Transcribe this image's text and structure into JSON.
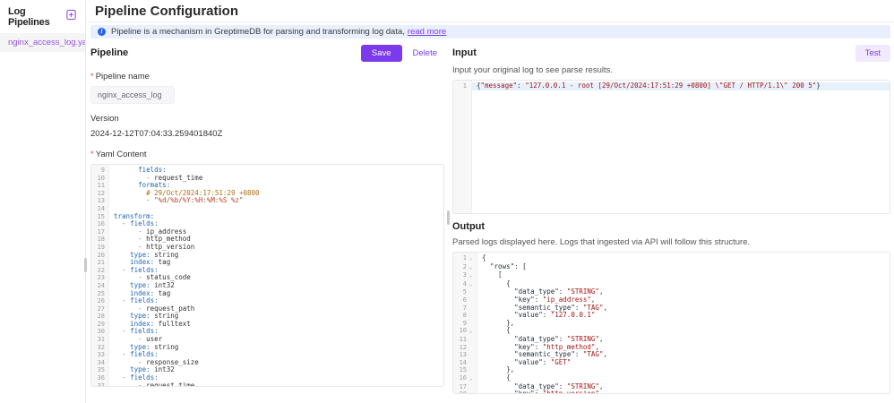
{
  "accent": "#7c3aed",
  "sidebar": {
    "title": "Log Pipelines",
    "items": [
      {
        "label": "nginx_access_log.yaml",
        "selected": true
      }
    ]
  },
  "header": {
    "title": "Pipeline Configuration"
  },
  "banner": {
    "text": "Pipeline is a mechanism in GreptimeDB for parsing and transforming log data,",
    "link": "read more"
  },
  "pipeline": {
    "heading": "Pipeline",
    "save_label": "Save",
    "delete_label": "Delete",
    "required_marker": "*",
    "name_label": "Pipeline name",
    "name_value": "nginx_access_log",
    "version_label": "Version",
    "version_value": "2024-12-12T07:04:33.259401840Z",
    "yaml_label": "Yaml Content"
  },
  "input": {
    "heading": "Input",
    "test_label": "Test",
    "caption": "Input your original log to see parse results."
  },
  "output": {
    "heading": "Output",
    "caption": "Parsed logs displayed here. Logs that ingested via API will follow this structure."
  },
  "editors": {
    "yaml": {
      "lines": [
        {
          "n": 9,
          "segs": [
            [
              "pl",
              "      "
            ],
            [
              "ky",
              "fields:"
            ]
          ]
        },
        {
          "n": 10,
          "segs": [
            [
              "pl",
              "        "
            ],
            [
              "mt",
              "- "
            ],
            [
              "pl",
              "request_time"
            ]
          ]
        },
        {
          "n": 11,
          "segs": [
            [
              "pl",
              "      "
            ],
            [
              "ky",
              "formats:"
            ]
          ]
        },
        {
          "n": 12,
          "segs": [
            [
              "pl",
              "        "
            ],
            [
              "cm",
              "# 29/Oct/2024:17:51:29 +0800"
            ]
          ]
        },
        {
          "n": 13,
          "segs": [
            [
              "pl",
              "        "
            ],
            [
              "mt",
              "- "
            ],
            [
              "st",
              "\"%d/%b/%Y:%H:%M:%S %z\""
            ]
          ]
        },
        {
          "n": 14,
          "segs": []
        },
        {
          "n": 15,
          "segs": [
            [
              "ky",
              "transform:"
            ]
          ]
        },
        {
          "n": 16,
          "segs": [
            [
              "pl",
              "  "
            ],
            [
              "mt",
              "- "
            ],
            [
              "ky",
              "fields:"
            ]
          ]
        },
        {
          "n": 17,
          "segs": [
            [
              "pl",
              "      "
            ],
            [
              "mt",
              "- "
            ],
            [
              "pl",
              "ip_address"
            ]
          ]
        },
        {
          "n": 18,
          "segs": [
            [
              "pl",
              "      "
            ],
            [
              "mt",
              "- "
            ],
            [
              "pl",
              "http_method"
            ]
          ]
        },
        {
          "n": 19,
          "segs": [
            [
              "pl",
              "      "
            ],
            [
              "mt",
              "- "
            ],
            [
              "pl",
              "http_version"
            ]
          ]
        },
        {
          "n": 20,
          "segs": [
            [
              "pl",
              "    "
            ],
            [
              "ky",
              "type:"
            ],
            [
              "pl",
              " string"
            ]
          ]
        },
        {
          "n": 21,
          "segs": [
            [
              "pl",
              "    "
            ],
            [
              "ky",
              "index:"
            ],
            [
              "pl",
              " tag"
            ]
          ]
        },
        {
          "n": 22,
          "segs": [
            [
              "pl",
              "  "
            ],
            [
              "mt",
              "- "
            ],
            [
              "ky",
              "fields:"
            ]
          ]
        },
        {
          "n": 23,
          "segs": [
            [
              "pl",
              "      "
            ],
            [
              "mt",
              "- "
            ],
            [
              "pl",
              "status_code"
            ]
          ]
        },
        {
          "n": 24,
          "segs": [
            [
              "pl",
              "    "
            ],
            [
              "ky",
              "type:"
            ],
            [
              "pl",
              " int32"
            ]
          ]
        },
        {
          "n": 25,
          "segs": [
            [
              "pl",
              "    "
            ],
            [
              "ky",
              "index:"
            ],
            [
              "pl",
              " tag"
            ]
          ]
        },
        {
          "n": 26,
          "segs": [
            [
              "pl",
              "  "
            ],
            [
              "mt",
              "- "
            ],
            [
              "ky",
              "fields:"
            ]
          ]
        },
        {
          "n": 27,
          "segs": [
            [
              "pl",
              "      "
            ],
            [
              "mt",
              "- "
            ],
            [
              "pl",
              "request_path"
            ]
          ]
        },
        {
          "n": 28,
          "segs": [
            [
              "pl",
              "    "
            ],
            [
              "ky",
              "type:"
            ],
            [
              "pl",
              " string"
            ]
          ]
        },
        {
          "n": 29,
          "segs": [
            [
              "pl",
              "    "
            ],
            [
              "ky",
              "index:"
            ],
            [
              "pl",
              " fulltext"
            ]
          ]
        },
        {
          "n": 30,
          "segs": [
            [
              "pl",
              "  "
            ],
            [
              "mt",
              "- "
            ],
            [
              "ky",
              "fields:"
            ]
          ]
        },
        {
          "n": 31,
          "segs": [
            [
              "pl",
              "      "
            ],
            [
              "mt",
              "- "
            ],
            [
              "pl",
              "user"
            ]
          ]
        },
        {
          "n": 32,
          "segs": [
            [
              "pl",
              "    "
            ],
            [
              "ky",
              "type:"
            ],
            [
              "pl",
              " string"
            ]
          ]
        },
        {
          "n": 33,
          "segs": [
            [
              "pl",
              "  "
            ],
            [
              "mt",
              "- "
            ],
            [
              "ky",
              "fields:"
            ]
          ]
        },
        {
          "n": 34,
          "segs": [
            [
              "pl",
              "      "
            ],
            [
              "mt",
              "- "
            ],
            [
              "pl",
              "response_size"
            ]
          ]
        },
        {
          "n": 35,
          "segs": [
            [
              "pl",
              "    "
            ],
            [
              "ky",
              "type:"
            ],
            [
              "pl",
              " int32"
            ]
          ]
        },
        {
          "n": 36,
          "segs": [
            [
              "pl",
              "  "
            ],
            [
              "mt",
              "- "
            ],
            [
              "ky",
              "fields:"
            ]
          ]
        },
        {
          "n": 37,
          "segs": [
            [
              "pl",
              "      "
            ],
            [
              "mt",
              "- "
            ],
            [
              "pl",
              "request_time"
            ]
          ]
        }
      ]
    },
    "input": {
      "lines": [
        {
          "n": 1,
          "active": true,
          "segs": [
            [
              "pl",
              "{"
            ],
            [
              "js",
              "\"message\""
            ],
            [
              "pl",
              ": "
            ],
            [
              "js",
              "\"127.0.0.1 - root [29/Oct/2024:17:51:29 +0800] \\\"GET / HTTP/1.1\\\" 200 5\""
            ],
            [
              "pl",
              "}"
            ]
          ]
        }
      ]
    },
    "output": {
      "lines": [
        {
          "n": 1,
          "fold": true,
          "segs": [
            [
              "pl",
              "{"
            ]
          ]
        },
        {
          "n": 2,
          "fold": true,
          "segs": [
            [
              "pl",
              "  "
            ],
            [
              "jk",
              "\"rows\""
            ],
            [
              "pl",
              ": ["
            ]
          ]
        },
        {
          "n": 3,
          "fold": true,
          "segs": [
            [
              "pl",
              "    ["
            ]
          ]
        },
        {
          "n": 4,
          "fold": true,
          "segs": [
            [
              "pl",
              "      {"
            ]
          ]
        },
        {
          "n": 5,
          "segs": [
            [
              "pl",
              "        "
            ],
            [
              "jk",
              "\"data_type\""
            ],
            [
              "pl",
              ": "
            ],
            [
              "js",
              "\"STRING\""
            ],
            [
              "pl",
              ","
            ]
          ]
        },
        {
          "n": 6,
          "segs": [
            [
              "pl",
              "        "
            ],
            [
              "jk",
              "\"key\""
            ],
            [
              "pl",
              ": "
            ],
            [
              "js",
              "\"ip_address\""
            ],
            [
              "pl",
              ","
            ]
          ]
        },
        {
          "n": 7,
          "segs": [
            [
              "pl",
              "        "
            ],
            [
              "jk",
              "\"semantic_type\""
            ],
            [
              "pl",
              ": "
            ],
            [
              "js",
              "\"TAG\""
            ],
            [
              "pl",
              ","
            ]
          ]
        },
        {
          "n": 8,
          "segs": [
            [
              "pl",
              "        "
            ],
            [
              "jk",
              "\"value\""
            ],
            [
              "pl",
              ": "
            ],
            [
              "js",
              "\"127.0.0.1\""
            ]
          ]
        },
        {
          "n": 9,
          "segs": [
            [
              "pl",
              "      },"
            ]
          ]
        },
        {
          "n": 10,
          "fold": true,
          "segs": [
            [
              "pl",
              "      {"
            ]
          ]
        },
        {
          "n": 11,
          "segs": [
            [
              "pl",
              "        "
            ],
            [
              "jk",
              "\"data_type\""
            ],
            [
              "pl",
              ": "
            ],
            [
              "js",
              "\"STRING\""
            ],
            [
              "pl",
              ","
            ]
          ]
        },
        {
          "n": 12,
          "segs": [
            [
              "pl",
              "        "
            ],
            [
              "jk",
              "\"key\""
            ],
            [
              "pl",
              ": "
            ],
            [
              "js",
              "\"http_method\""
            ],
            [
              "pl",
              ","
            ]
          ]
        },
        {
          "n": 13,
          "segs": [
            [
              "pl",
              "        "
            ],
            [
              "jk",
              "\"semantic_type\""
            ],
            [
              "pl",
              ": "
            ],
            [
              "js",
              "\"TAG\""
            ],
            [
              "pl",
              ","
            ]
          ]
        },
        {
          "n": 14,
          "segs": [
            [
              "pl",
              "        "
            ],
            [
              "jk",
              "\"value\""
            ],
            [
              "pl",
              ": "
            ],
            [
              "js",
              "\"GET\""
            ]
          ]
        },
        {
          "n": 15,
          "segs": [
            [
              "pl",
              "      },"
            ]
          ]
        },
        {
          "n": 16,
          "fold": true,
          "segs": [
            [
              "pl",
              "      {"
            ]
          ]
        },
        {
          "n": 17,
          "segs": [
            [
              "pl",
              "        "
            ],
            [
              "jk",
              "\"data_type\""
            ],
            [
              "pl",
              ": "
            ],
            [
              "js",
              "\"STRING\""
            ],
            [
              "pl",
              ","
            ]
          ]
        },
        {
          "n": 18,
          "segs": [
            [
              "pl",
              "        "
            ],
            [
              "jk",
              "\"key\""
            ],
            [
              "pl",
              ": "
            ],
            [
              "js",
              "\"http_version\""
            ],
            [
              "pl",
              ","
            ]
          ]
        }
      ]
    }
  }
}
